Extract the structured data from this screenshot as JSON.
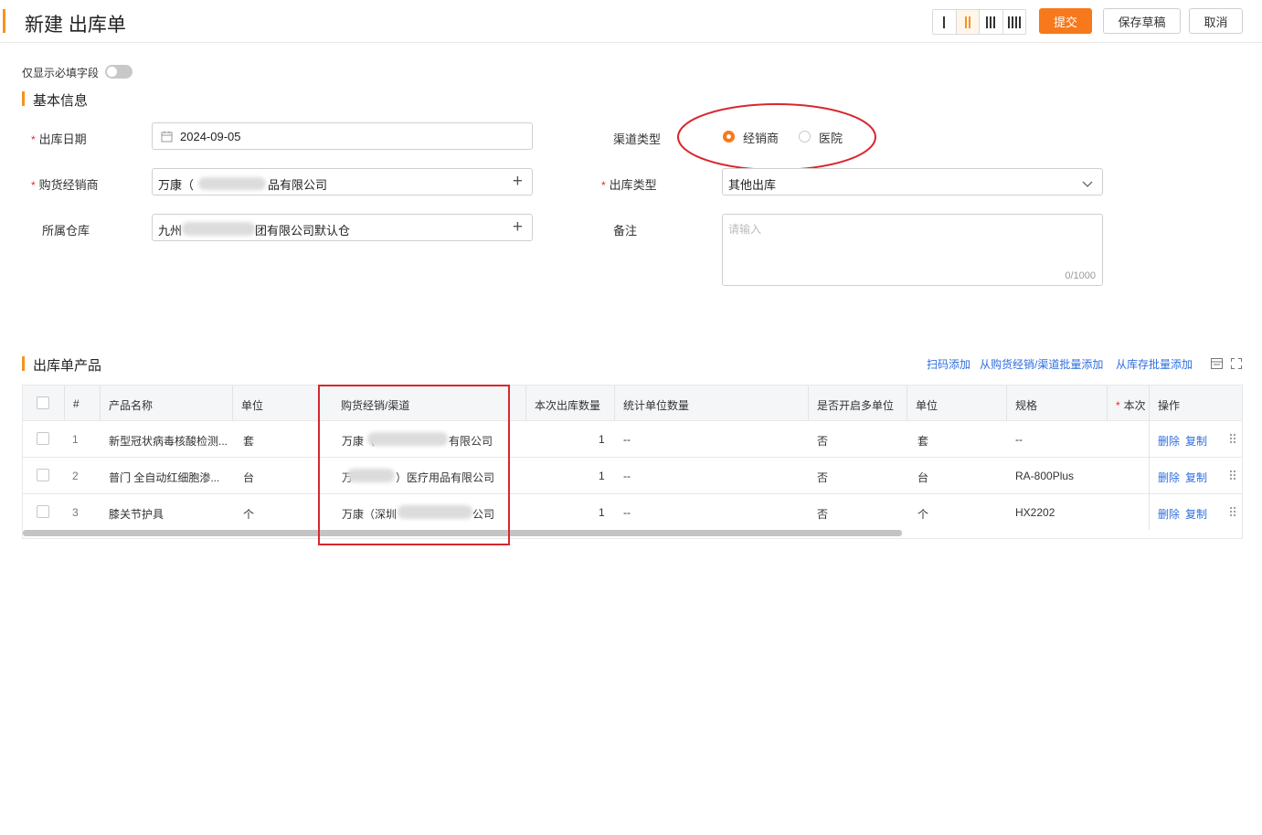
{
  "header": {
    "title": "新建 出库单",
    "submit_label": "提交",
    "save_draft_label": "保存草稿",
    "cancel_label": "取消"
  },
  "toggle": {
    "label": "仅显示必填字段"
  },
  "basic": {
    "section_title": "基本信息",
    "date_label": "出库日期",
    "date_value": "2024-09-05",
    "dealer_label": "购货经销商",
    "dealer_value_prefix": "万康（",
    "dealer_value_suffix": "品有限公司",
    "warehouse_label": "所属仓库",
    "warehouse_value_prefix": "九州",
    "warehouse_value_suffix": "团有限公司默认仓",
    "channel_label": "渠道类型",
    "channel_options": [
      "经销商",
      "医院"
    ],
    "outtype_label": "出库类型",
    "outtype_value": "其他出库",
    "remark_label": "备注",
    "remark_placeholder": "请输入",
    "remark_count": "0/1000"
  },
  "products": {
    "section_title": "出库单产品",
    "action_scan": "扫码添加",
    "action_batch_dealer": "从购货经销/渠道批量添加",
    "action_batch_stock": "从库存批量添加",
    "columns": [
      "#",
      "产品名称",
      "单位",
      "购货经销/渠道",
      "本次出库数量",
      "统计单位数量",
      "是否开启多单位",
      "单位",
      "规格",
      "本次",
      "操作"
    ],
    "rows": [
      {
        "index": "1",
        "name": "新型冠状病毒核酸检测...",
        "unit": "套",
        "channel_prefix": "万康（",
        "channel_suffix": "有限公司",
        "qty": "1",
        "stat_qty": "--",
        "multi_unit": "否",
        "unit2": "套",
        "spec": "--",
        "delete": "删除",
        "copy": "复制"
      },
      {
        "index": "2",
        "name": "普门 全自动红细胞渗...",
        "unit": "台",
        "channel_prefix": "万",
        "channel_suffix": "）医疗用品有限公司",
        "qty": "1",
        "stat_qty": "--",
        "multi_unit": "否",
        "unit2": "台",
        "spec": "RA-800Plus",
        "delete": "删除",
        "copy": "复制"
      },
      {
        "index": "3",
        "name": "膝关节护具",
        "unit": "个",
        "channel_prefix": "万康（深圳",
        "channel_suffix": "公司",
        "qty": "1",
        "stat_qty": "--",
        "multi_unit": "否",
        "unit2": "个",
        "spec": "HX2202",
        "delete": "删除",
        "copy": "复制"
      }
    ]
  },
  "colors": {
    "accent": "#f7791b",
    "highlight": "#d9272e",
    "link": "#2f6fe0"
  }
}
